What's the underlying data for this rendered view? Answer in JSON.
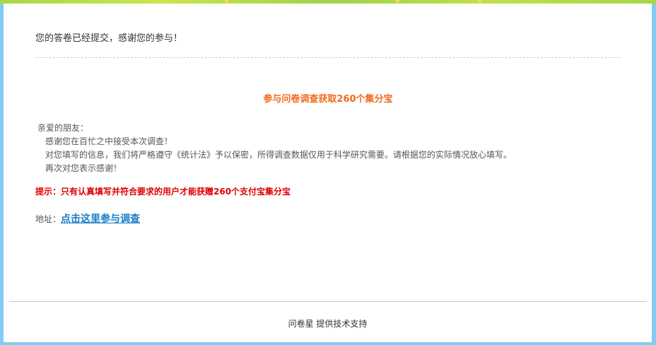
{
  "submit_message": "您的答卷已经提交，感谢您的参与！",
  "promo_title": "参与问卷调查获取260个集分宝",
  "letter": {
    "greeting": "亲爱的朋友：",
    "line1": "感谢您在百忙之中接受本次调查！",
    "line2": "对您填写的信息，我们将严格遵守《统计法》予以保密，所得调查数据仅用于科学研究需要。请根据您的实际情况放心填写。",
    "line3": "再次对您表示感谢！"
  },
  "tip": "提示：只有认真填写并符合要求的用户才能获赠260个支付宝集分宝",
  "address": {
    "label": "地址：",
    "link_text": "点击这里参与调查"
  },
  "footer": "问卷星 提供技术支持",
  "colors": {
    "frame": "#7fcdf5",
    "promo": "#f26a1b",
    "tip": "#e00000",
    "link": "#1a7fc4"
  }
}
